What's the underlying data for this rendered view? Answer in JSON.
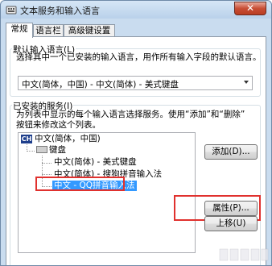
{
  "window": {
    "title": "文本服务和输入语言",
    "close_glyph": "✕"
  },
  "tabs": [
    "常规",
    "语言栏",
    "高级键设置"
  ],
  "default_language": {
    "title": "默认输入语言(L)",
    "description": "选择其中一个已安装的输入语言，用作所有输入字段的默认语言。",
    "selected": "中文(简体，中国) - 中文(简体) - 美式键盘"
  },
  "installed_services": {
    "title": "已安装的服务(I)",
    "description_lines": [
      "为列表中显示的每个输入语言选择服务。使用“添加”和“删除”",
      "按钮来修改这个列表。"
    ],
    "language_icon": "CH",
    "language": "中文(简体，中国)",
    "category": "键盘",
    "services": [
      {
        "label": "中文(简体) - 美式键盘",
        "selected": false
      },
      {
        "label": "中文(简体) - 搜狗拼音输入法",
        "selected": false
      },
      {
        "label": "中文 - QQ拼音输入法",
        "selected": true
      }
    ]
  },
  "buttons": {
    "add": "添加(D)...",
    "properties": "属性(P)...",
    "move_up": "上移(U)"
  },
  "colors": {
    "highlight_box": "#e0312e",
    "selection": "#3399ff"
  }
}
